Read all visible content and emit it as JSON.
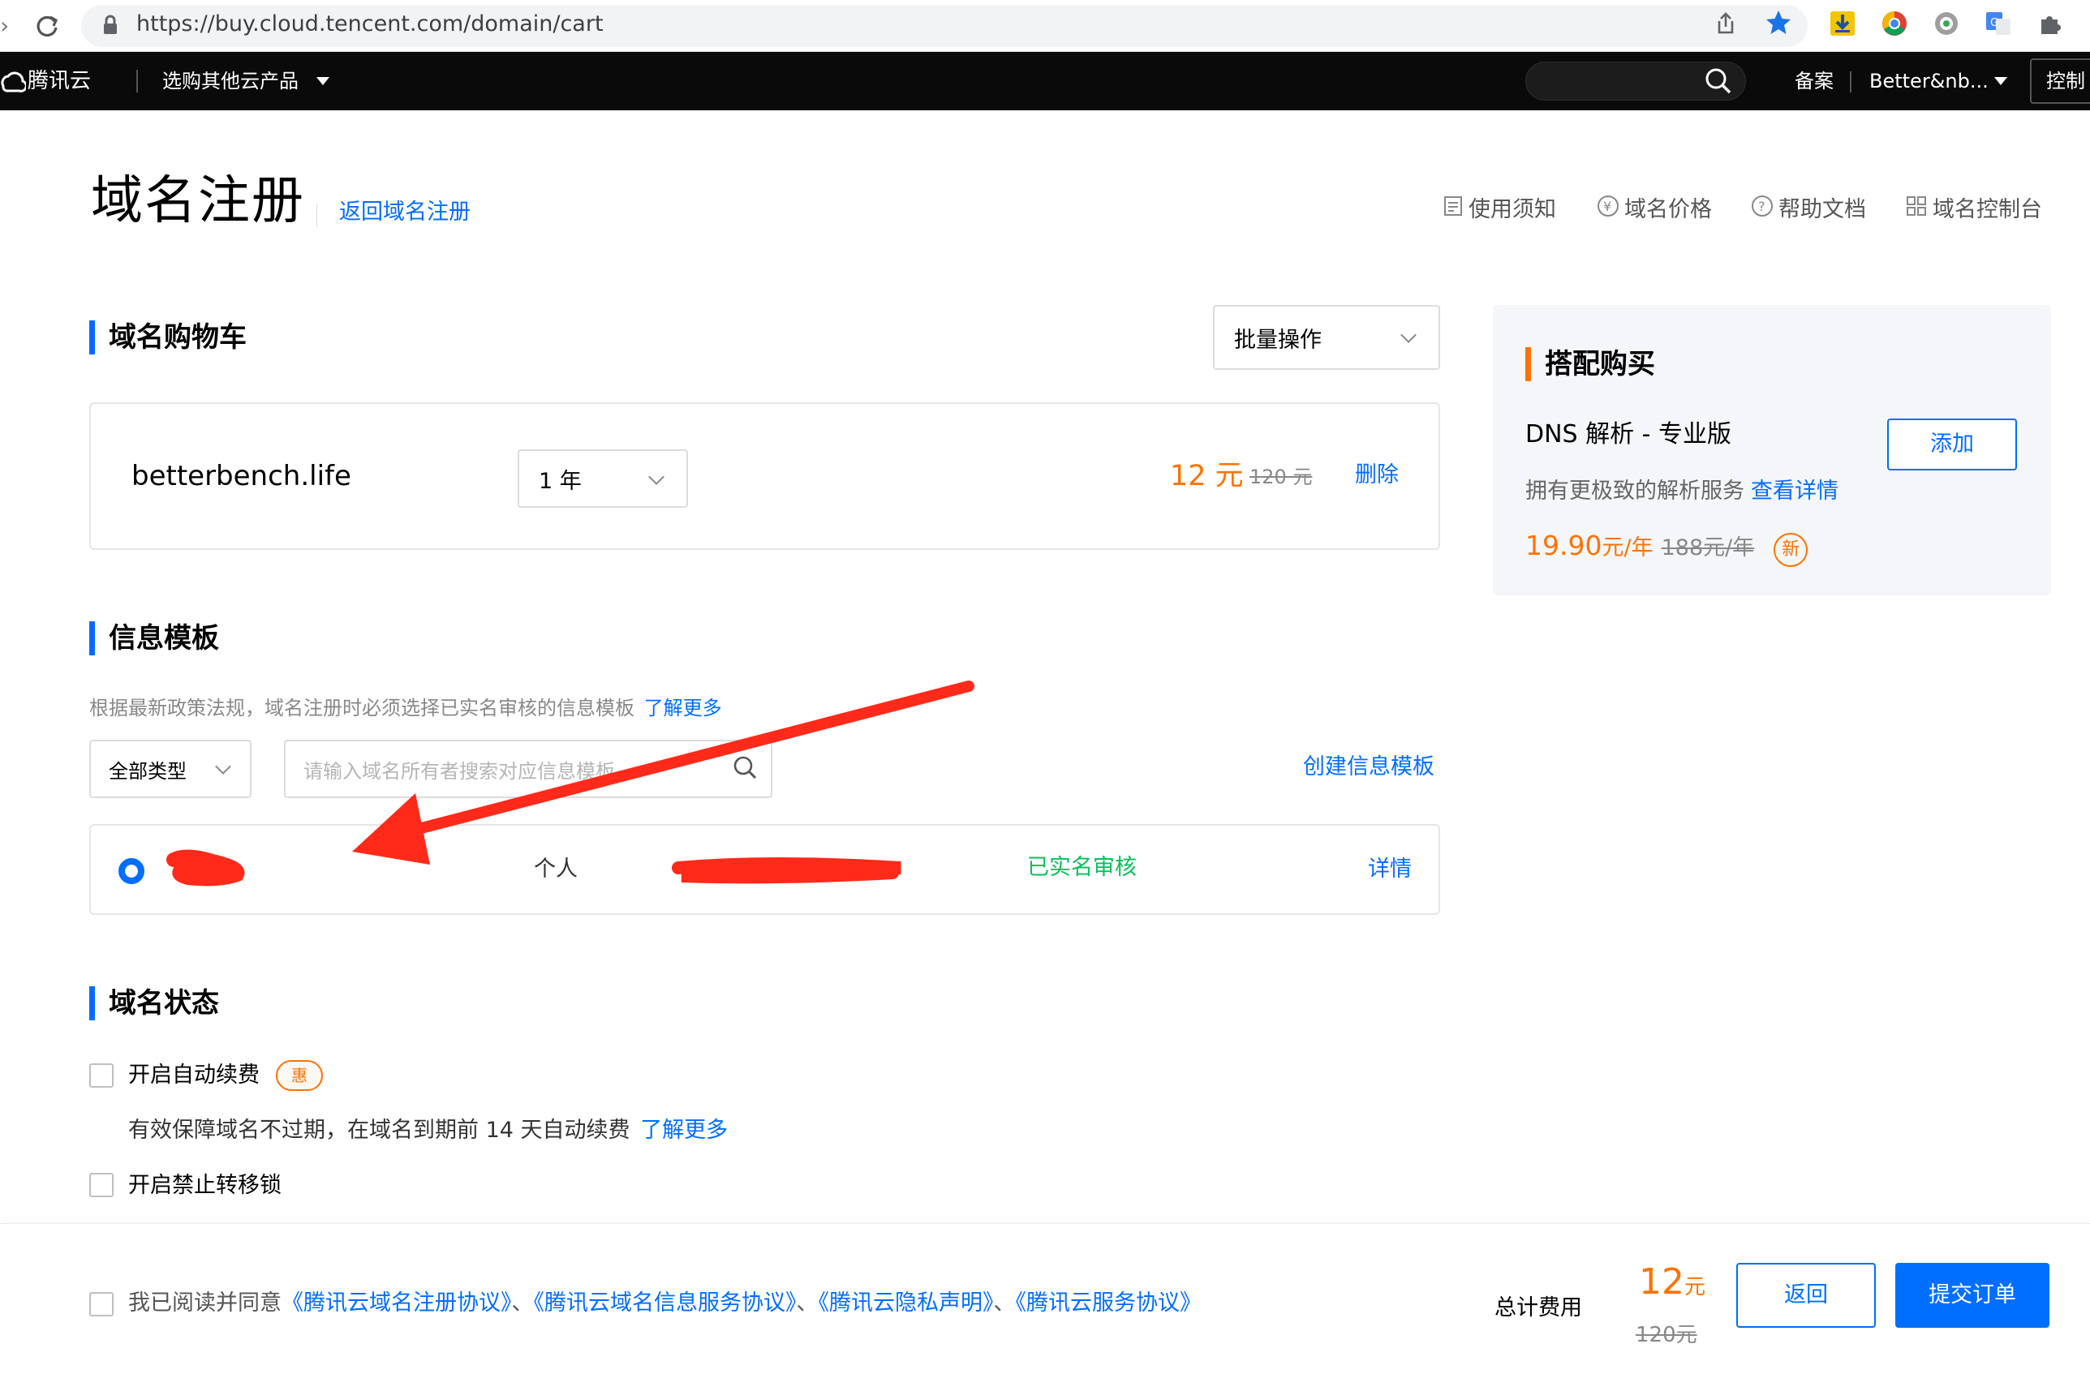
{
  "browser": {
    "url": "https://buy.cloud.tencent.com/domain/cart"
  },
  "nav": {
    "brand": "腾讯云",
    "products_menu": "选购其他云产品",
    "filing": "备案",
    "account": "Better&nb...",
    "console": "控制"
  },
  "header": {
    "title": "域名注册",
    "back_link": "返回域名注册",
    "links": [
      "使用须知",
      "域名价格",
      "帮助文档",
      "域名控制台"
    ]
  },
  "cart": {
    "section_title": "域名购物车",
    "batch_label": "批量操作",
    "domain": "betterbench.life",
    "term": "1 年",
    "price": "12 元",
    "original_price": "120 元",
    "delete_label": "删除"
  },
  "addon": {
    "section_title": "搭配购买",
    "product": "DNS 解析 - 专业版",
    "add_label": "添加",
    "desc": "拥有更极致的解析服务",
    "detail_link": "查看详情",
    "price_num": "19.90",
    "price_unit": "元/年",
    "original_price": "188元/年",
    "badge": "新"
  },
  "template": {
    "section_title": "信息模板",
    "notice": "根据最新政策法规，域名注册时必须选择已实名审核的信息模板",
    "learn_more": "了解更多",
    "type_filter": "全部类型",
    "search_placeholder": "请输入域名所有者搜索对应信息模板",
    "create_link": "创建信息模板",
    "row": {
      "type": "个人",
      "status": "已实名审核",
      "detail": "详情"
    }
  },
  "status": {
    "section_title": "域名状态",
    "auto_renew_label": "开启自动续费",
    "auto_renew_badge": "惠",
    "auto_renew_desc": "有效保障域名不过期，在域名到期前 14 天自动续费",
    "learn_more": "了解更多",
    "transfer_lock_label": "开启禁止转移锁"
  },
  "footer": {
    "agree_prefix": "我已阅读并同意",
    "agreement_1": "《腾讯云域名注册协议》",
    "sep": "、",
    "agreement_2": "《腾讯云域名信息服务协议》",
    "agreement_3": "《腾讯云隐私声明》",
    "agreement_4": "《腾讯云服务协议》",
    "total_label": "总计费用",
    "total_num": "12",
    "total_unit": "元",
    "total_original": "120元",
    "back_button": "返回",
    "submit_button": "提交订单"
  },
  "colors": {
    "accent": "#006eff",
    "price": "#ff7200",
    "verified": "#0abf5b",
    "annotation": "#ff2a1a"
  }
}
